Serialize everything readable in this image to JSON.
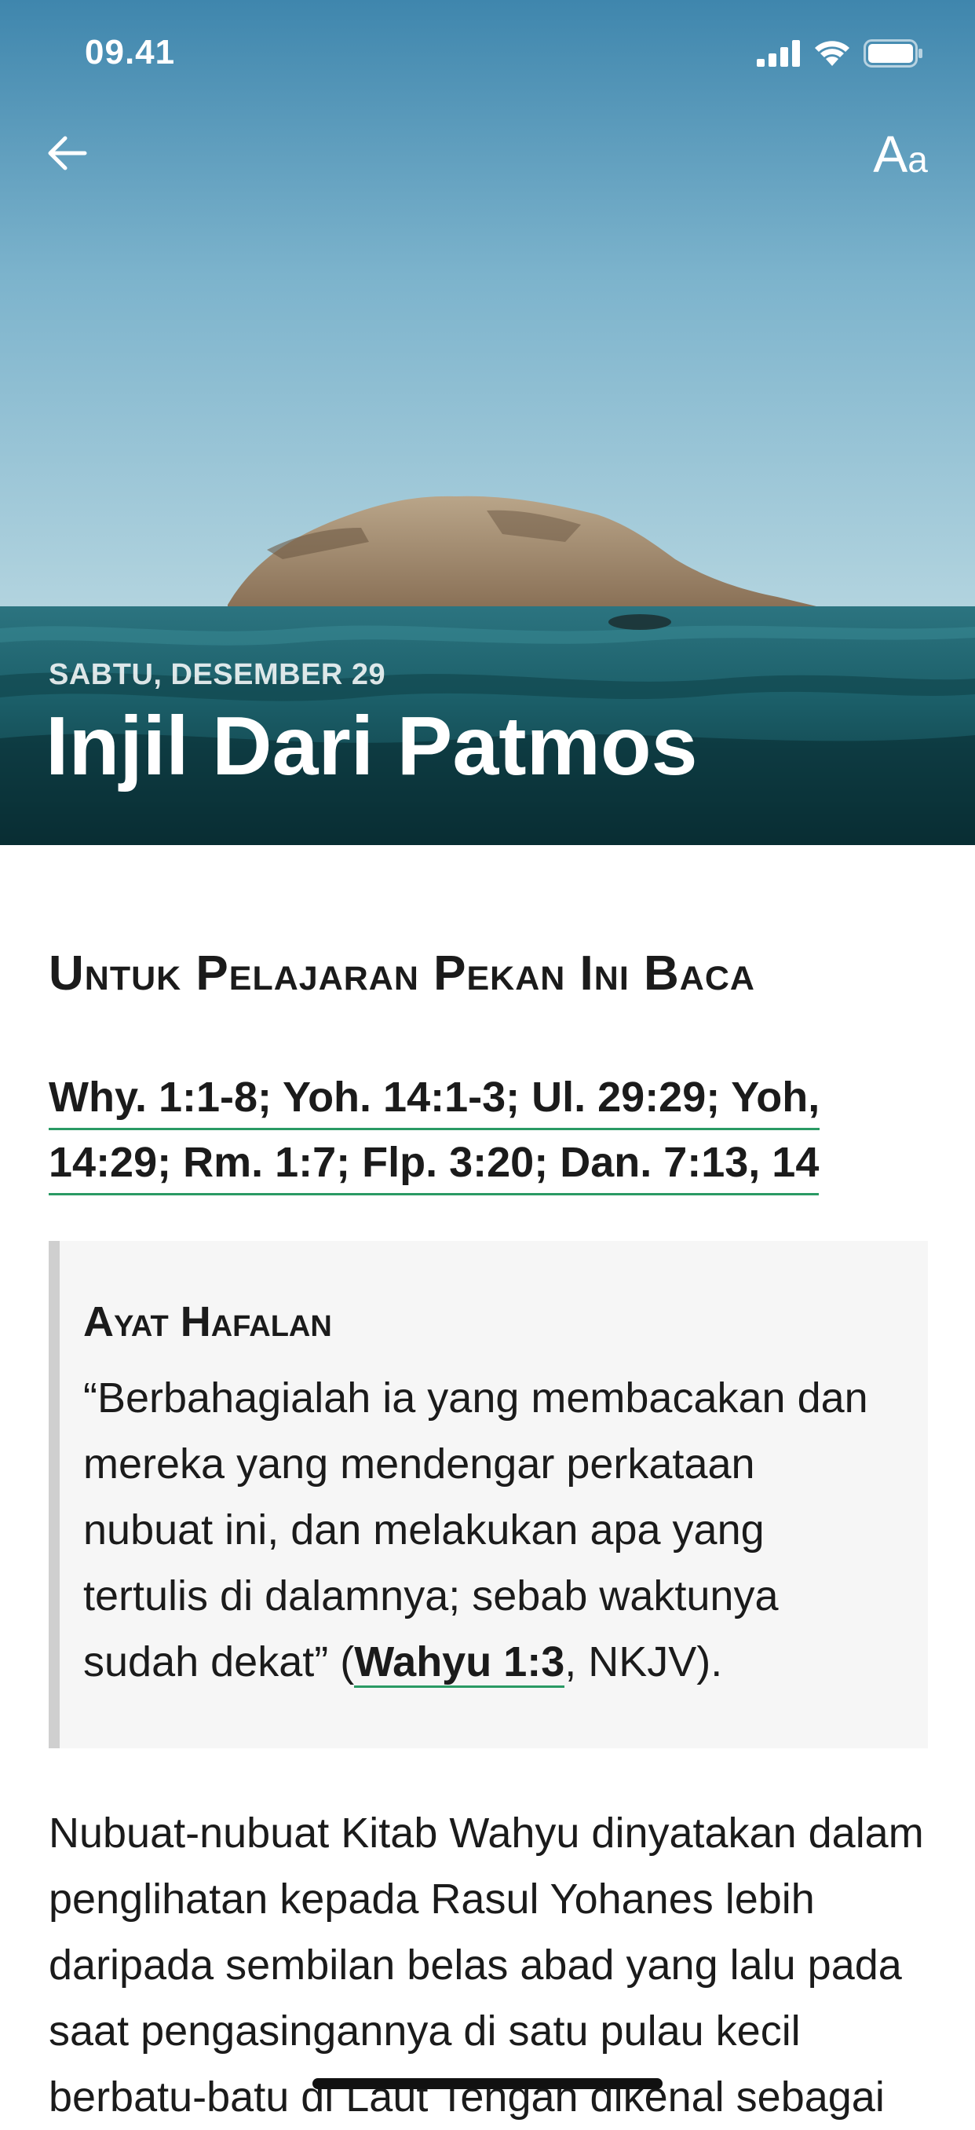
{
  "status_bar": {
    "time": "09.41",
    "icons": [
      "signal-icon",
      "wifi-icon",
      "battery-icon"
    ]
  },
  "header": {
    "back_icon": "arrow-left-icon",
    "font_size_label_big": "A",
    "font_size_label_small": "a"
  },
  "hero": {
    "date": "SABTU, DESEMBER 29",
    "title": "Injil Dari Patmos"
  },
  "reading": {
    "heading": "Untuk Pelajaran Pekan Ini Baca",
    "references_line1": "Why. 1:1-8; Yoh. 14:1-3; Ul. 29:29; Yoh,",
    "references_line2": "14:29; Rm. 1:7; Flp. 3:20; Dan. 7:13, 14"
  },
  "memory": {
    "title": "Ayat Hafalan",
    "text": "“Berbahagialah ia yang membacakan dan mereka yang mendengar perkataan nubuat ini, dan melakukan apa yang tertulis di dalamnya; sebab waktunya sudah dekat” (",
    "reference": "Wahyu 1:3",
    "suffix": ", NKJV)."
  },
  "body": {
    "paragraph": "Nubuat-nubuat Kitab Wahyu dinyatakan dalam penglihatan kepada Rasul Yohanes lebih daripada sembilan belas abad yang lalu pada saat pengasingannya di satu pulau kecil berbatu-batu di Laut Tengah dikenal sebagai"
  },
  "colors": {
    "link_underline": "#2a9a64",
    "memory_bg": "#f6f6f6",
    "memory_border": "#cfcfcf",
    "text": "#1b1b1b"
  }
}
